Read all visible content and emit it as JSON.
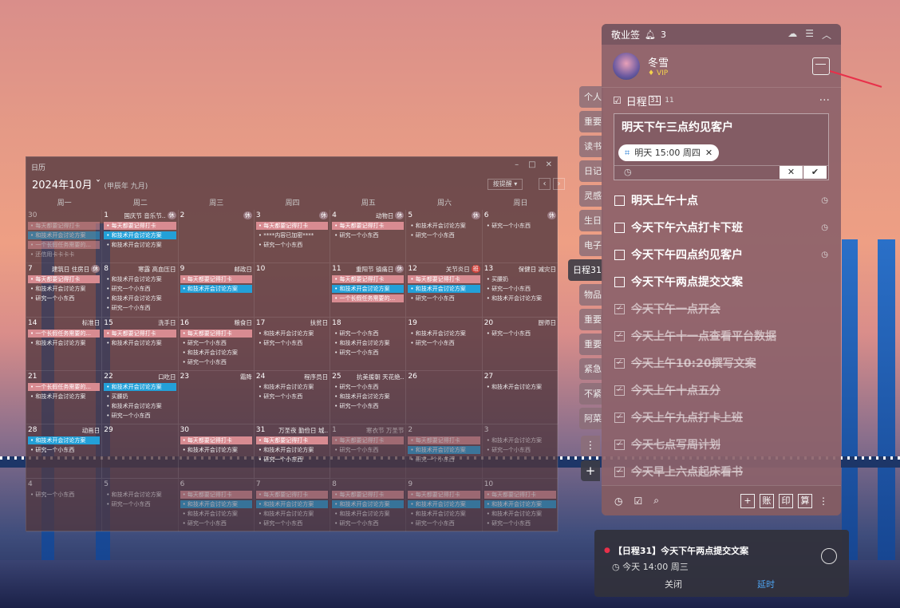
{
  "calendar": {
    "window_title": "日历",
    "month": "2024年10月",
    "lunar": "(甲辰年 九月)",
    "remind_btn": "按提醒",
    "weekdays": [
      "周一",
      "周二",
      "周三",
      "周四",
      "周五",
      "周六",
      "周日"
    ],
    "weeks": [
      [
        {
          "d": "30",
          "dim": true,
          "fest": "",
          "tag": "",
          "ev": [
            [
              "pink",
              "每天都要记得打卡"
            ],
            [
              "blue",
              "和技术开会讨论方案"
            ],
            [
              "pink",
              "一个长假任务需要的..."
            ],
            [
              "plain",
              "还信用卡卡卡卡"
            ]
          ]
        },
        {
          "d": "1",
          "fest": "国庆节 音乐节..",
          "tag": "休",
          "ev": [
            [
              "pink",
              "每天都要记得打卡"
            ],
            [
              "blue",
              "和技术开会讨论方案"
            ],
            [
              "plain",
              "和技术开会讨论方案"
            ]
          ]
        },
        {
          "d": "2",
          "fest": "",
          "tag": "休",
          "ev": []
        },
        {
          "d": "3",
          "fest": "",
          "tag": "休",
          "ev": [
            [
              "pink",
              "每天都要记得打卡"
            ],
            [
              "plain",
              "****内容已加密****"
            ],
            [
              "plain",
              "研究一个小东西"
            ]
          ]
        },
        {
          "d": "4",
          "fest": "动物日",
          "tag": "休",
          "ev": [
            [
              "pink",
              "每天都要记得打卡"
            ],
            [
              "plain",
              "研究一个小东西"
            ]
          ]
        },
        {
          "d": "5",
          "fest": "",
          "tag": "休",
          "ev": [
            [
              "plain",
              "和技术开会讨论方案"
            ],
            [
              "plain",
              "研究一个小东西"
            ]
          ]
        },
        {
          "d": "6",
          "fest": "",
          "tag": "休",
          "ev": [
            [
              "plain",
              "研究一个小东西"
            ]
          ]
        }
      ],
      [
        {
          "d": "7",
          "fest": "建筑日 住房日",
          "tag": "休",
          "ev": [
            [
              "pink",
              "每天都要记得打卡"
            ],
            [
              "plain",
              "和技术开会讨论方案"
            ],
            [
              "plain",
              "研究一个小东西"
            ]
          ]
        },
        {
          "d": "8",
          "fest": "寒露 高血压日",
          "tag": "",
          "ev": [
            [
              "plain",
              "和技术开会讨论方案"
            ],
            [
              "plain",
              "研究一个小东西"
            ],
            [
              "plain",
              "和技术开会讨论方案"
            ],
            [
              "plain",
              "研究一个小东西"
            ]
          ]
        },
        {
          "d": "9",
          "fest": "邮政日",
          "tag": "",
          "ev": [
            [
              "pink",
              "每天都要记得打卡"
            ],
            [
              "blue",
              "和技术开会讨论方案"
            ]
          ]
        },
        {
          "d": "10",
          "fest": "",
          "tag": "",
          "ev": []
        },
        {
          "d": "11",
          "fest": "重阳节 镇痛日",
          "tag": "休",
          "ev": [
            [
              "pink",
              "每天都要记得打卡"
            ],
            [
              "blue",
              "和技术开会讨论方案"
            ],
            [
              "pink",
              "一个长假任务需要的..."
            ]
          ]
        },
        {
          "d": "12",
          "fest": "关节炎日",
          "tag": "班",
          "ev": [
            [
              "pink",
              "每天都要记得打卡"
            ],
            [
              "blue",
              "和技术开会讨论方案"
            ],
            [
              "plain",
              "研究一个小东西"
            ]
          ]
        },
        {
          "d": "13",
          "fest": "保健日 减灾日",
          "tag": "",
          "ev": [
            [
              "plain",
              "买腰奶"
            ],
            [
              "plain",
              "研究一个小东西"
            ],
            [
              "plain",
              "和技术开会讨论方案"
            ]
          ]
        }
      ],
      [
        {
          "d": "14",
          "fest": "标准日",
          "tag": "",
          "ev": [
            [
              "pink",
              "一个长假任务需要的..."
            ],
            [
              "plain",
              "和技术开会讨论方案"
            ]
          ]
        },
        {
          "d": "15",
          "fest": "洗手日",
          "tag": "",
          "ev": [
            [
              "pink",
              "每天都要记得打卡"
            ],
            [
              "plain",
              "和技术开会讨论方案"
            ]
          ]
        },
        {
          "d": "16",
          "fest": "粮食日",
          "tag": "",
          "ev": [
            [
              "pink",
              "每天都要记得打卡"
            ],
            [
              "plain",
              "研究一个小东西"
            ],
            [
              "plain",
              "和技术开会讨论方案"
            ],
            [
              "plain",
              "研究一个小东西"
            ]
          ]
        },
        {
          "d": "17",
          "fest": "扶贫日",
          "tag": "",
          "ev": [
            [
              "plain",
              "和技术开会讨论方案"
            ],
            [
              "plain",
              "研究一个小东西"
            ]
          ]
        },
        {
          "d": "18",
          "fest": "",
          "tag": "",
          "ev": [
            [
              "plain",
              "研究一个小东西"
            ],
            [
              "plain",
              "和技术开会讨论方案"
            ],
            [
              "plain",
              "研究一个小东西"
            ]
          ]
        },
        {
          "d": "19",
          "fest": "",
          "tag": "",
          "ev": [
            [
              "plain",
              "和技术开会讨论方案"
            ],
            [
              "plain",
              "研究一个小东西"
            ]
          ]
        },
        {
          "d": "20",
          "fest": "厨师日",
          "tag": "",
          "ev": [
            [
              "plain",
              "研究一个小东西"
            ]
          ]
        }
      ],
      [
        {
          "d": "21",
          "fest": "",
          "tag": "",
          "ev": [
            [
              "pink",
              "一个长假任务需要的..."
            ],
            [
              "plain",
              "和技术开会讨论方案"
            ]
          ]
        },
        {
          "d": "22",
          "fest": "口吃日",
          "tag": "",
          "ev": [
            [
              "blue",
              "和技术开会讨论方案"
            ],
            [
              "plain",
              "买腰奶"
            ],
            [
              "plain",
              "和技术开会讨论方案"
            ],
            [
              "plain",
              "研究一个小东西"
            ]
          ]
        },
        {
          "d": "23",
          "fest": "霜降",
          "tag": "",
          "ev": []
        },
        {
          "d": "24",
          "fest": "程序员日",
          "tag": "",
          "ev": [
            [
              "plain",
              "和技术开会讨论方案"
            ],
            [
              "plain",
              "研究一个小东西"
            ]
          ]
        },
        {
          "d": "25",
          "fest": "抗美援朝 天花绝..",
          "tag": "",
          "ev": [
            [
              "plain",
              "研究一个小东西"
            ],
            [
              "plain",
              "和技术开会讨论方案"
            ],
            [
              "plain",
              "研究一个小东西"
            ]
          ]
        },
        {
          "d": "26",
          "fest": "",
          "tag": "",
          "ev": []
        },
        {
          "d": "27",
          "fest": "",
          "tag": "",
          "ev": [
            [
              "plain",
              "和技术开会讨论方案"
            ]
          ]
        }
      ],
      [
        {
          "d": "28",
          "fest": "动画日",
          "tag": "",
          "ev": [
            [
              "blue",
              "和技术开会讨论方案"
            ],
            [
              "plain",
              "研究一个小东西"
            ]
          ]
        },
        {
          "d": "29",
          "fest": "",
          "tag": "",
          "ev": []
        },
        {
          "d": "30",
          "fest": "",
          "tag": "",
          "ev": [
            [
              "pink",
              "每天都要记得打卡"
            ],
            [
              "plain",
              "和技术开会讨论方案"
            ]
          ]
        },
        {
          "d": "31",
          "fest": "万圣夜 勤俭日 城..",
          "tag": "",
          "ev": [
            [
              "pink",
              "每天都要记得打卡"
            ],
            [
              "plain",
              "和技术开会讨论方案"
            ],
            [
              "plain",
              "研究一个小东西"
            ]
          ]
        },
        {
          "d": "1",
          "dim": true,
          "fest": "寒衣节 万圣节",
          "tag": "",
          "ev": [
            [
              "pink",
              "每天都要记得打卡"
            ],
            [
              "plain",
              "研究一个小东西"
            ]
          ]
        },
        {
          "d": "2",
          "dim": true,
          "fest": "",
          "tag": "",
          "ev": [
            [
              "pink",
              "每天都要记得打卡"
            ],
            [
              "blue",
              "和技术开会讨论方案"
            ],
            [
              "plain",
              "研究一个小东西"
            ]
          ]
        },
        {
          "d": "3",
          "dim": true,
          "fest": "",
          "tag": "",
          "ev": [
            [
              "plain",
              "和技术开会讨论方案"
            ],
            [
              "plain",
              "研究一个小东西"
            ]
          ]
        }
      ],
      [
        {
          "d": "4",
          "dim": true,
          "fest": "",
          "tag": "",
          "ev": [
            [
              "plain",
              "研究一个小东西"
            ]
          ]
        },
        {
          "d": "5",
          "dim": true,
          "fest": "",
          "tag": "",
          "ev": [
            [
              "plain",
              "和技术开会讨论方案"
            ],
            [
              "plain",
              "研究一个小东西"
            ]
          ]
        },
        {
          "d": "6",
          "dim": true,
          "fest": "",
          "tag": "",
          "ev": [
            [
              "pink",
              "每天都要记得打卡"
            ],
            [
              "blue",
              "和技术开会讨论方案"
            ],
            [
              "plain",
              "和技术开会讨论方案"
            ],
            [
              "plain",
              "研究一个小东西"
            ]
          ]
        },
        {
          "d": "7",
          "dim": true,
          "fest": "",
          "tag": "",
          "ev": [
            [
              "pink",
              "每天都要记得打卡"
            ],
            [
              "blue",
              "和技术开会讨论方案"
            ],
            [
              "plain",
              "和技术开会讨论方案"
            ],
            [
              "plain",
              "研究一个小东西"
            ]
          ]
        },
        {
          "d": "8",
          "dim": true,
          "fest": "",
          "tag": "",
          "ev": [
            [
              "pink",
              "每天都要记得打卡"
            ],
            [
              "blue",
              "和技术开会讨论方案"
            ],
            [
              "plain",
              "和技术开会讨论方案"
            ],
            [
              "plain",
              "研究一个小东西"
            ]
          ]
        },
        {
          "d": "9",
          "dim": true,
          "fest": "",
          "tag": "",
          "ev": [
            [
              "pink",
              "每天都要记得打卡"
            ],
            [
              "blue",
              "和技术开会讨论方案"
            ],
            [
              "plain",
              "和技术开会讨论方案"
            ],
            [
              "plain",
              "研究一个小东西"
            ]
          ]
        },
        {
          "d": "10",
          "dim": true,
          "fest": "",
          "tag": "",
          "ev": [
            [
              "pink",
              "每天都要记得打卡"
            ],
            [
              "blue",
              "和技术开会讨论方案"
            ],
            [
              "plain",
              "和技术开会讨论方案"
            ],
            [
              "plain",
              "研究一个小东西"
            ]
          ]
        }
      ]
    ]
  },
  "tabs": [
    "个人",
    "重要",
    "读书",
    "日记",
    "灵感",
    "生日",
    "电子",
    "日程31",
    "物品",
    "重要",
    "重要",
    "紧急",
    "不紧",
    "阿菜"
  ],
  "panel": {
    "app_name": "敬业签",
    "notif_count": "3",
    "user_name": "冬雪",
    "vip": "VIP",
    "section": "日程",
    "section_badge": "31",
    "section_count": "11",
    "input_text": "明天下午三点约见客户",
    "chip_text": "明天 15:00 周四",
    "todos": [
      {
        "text": "明天上午十点",
        "done": false,
        "clock": true
      },
      {
        "text": "今天下午六点打卡下班",
        "done": false,
        "clock": true
      },
      {
        "text": "今天下午四点约见客户",
        "done": false,
        "clock": true
      },
      {
        "text": "今天下午两点提交文案",
        "done": false,
        "clock": false
      },
      {
        "text": "今天下午一点开会",
        "done": true,
        "clock": false
      },
      {
        "text": "今天上午十一点查看平台数据",
        "done": true,
        "clock": false
      },
      {
        "text": "今天上午10:20撰写文案",
        "done": true,
        "clock": false
      },
      {
        "text": "今天上午十点五分",
        "done": true,
        "clock": false
      },
      {
        "text": "今天上午九点打卡上班",
        "done": true,
        "clock": false
      },
      {
        "text": "今天七点写周计划",
        "done": true,
        "clock": false
      },
      {
        "text": "今天早上六点起床看书",
        "done": true,
        "clock": false
      }
    ],
    "bottom_btns": [
      "+",
      "账",
      "印",
      "算"
    ]
  },
  "notification": {
    "title": "【日程31】今天下午两点提交文案",
    "time": "今天  14:00  周三",
    "close": "关闭",
    "delay": "延时"
  }
}
